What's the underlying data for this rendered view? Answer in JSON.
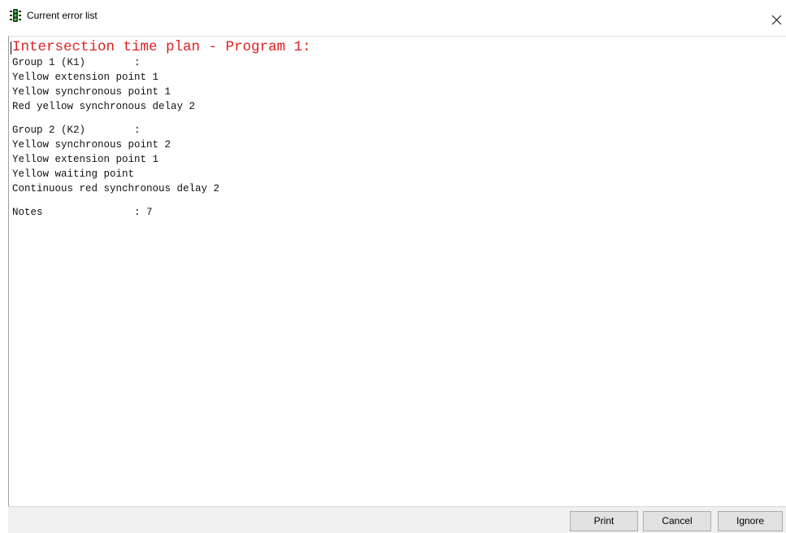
{
  "window": {
    "title": "Current error list",
    "app_icon": "traffic-light-icon",
    "close_icon": "close-icon"
  },
  "error_list": {
    "heading": "Intersection time plan - Program 1:",
    "heading_color": "#e02020",
    "group1": {
      "header": "Group 1 (K1)        :",
      "items": [
        "Yellow extension point 1",
        "Yellow synchronous point 1",
        "Red yellow synchronous delay 2"
      ]
    },
    "group2": {
      "header": "Group 2 (K2)        :",
      "items": [
        "Yellow synchronous point 2",
        "Yellow extension point 1",
        "Yellow waiting point",
        "Continuous red synchronous delay 2"
      ]
    },
    "notes": "Notes               : 7"
  },
  "buttons": {
    "print": "Print",
    "cancel": "Cancel",
    "ignore": "Ignore"
  }
}
